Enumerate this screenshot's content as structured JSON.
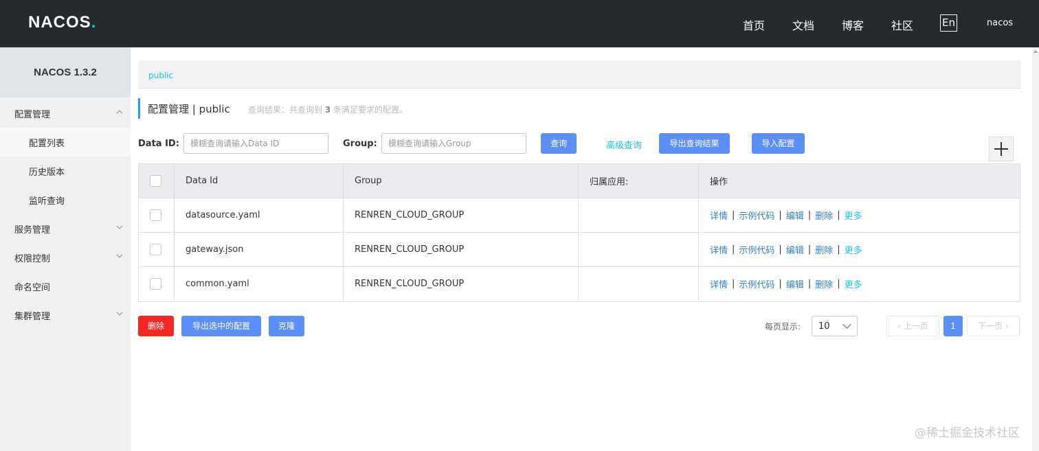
{
  "header": {
    "logo_text": "NACOS.",
    "nav": [
      "首页",
      "文档",
      "博客",
      "社区"
    ],
    "lang": "En",
    "user": "nacos"
  },
  "sidebar": {
    "title": "NACOS 1.3.2",
    "items": [
      {
        "label": "配置管理",
        "type": "group",
        "expanded": true
      },
      {
        "label": "配置列表",
        "type": "sub",
        "active": true
      },
      {
        "label": "历史版本",
        "type": "sub"
      },
      {
        "label": "监听查询",
        "type": "sub"
      },
      {
        "label": "服务管理",
        "type": "group",
        "expanded": false
      },
      {
        "label": "权限控制",
        "type": "group",
        "expanded": false
      },
      {
        "label": "命名空间",
        "type": "item"
      },
      {
        "label": "集群管理",
        "type": "group",
        "expanded": false
      }
    ]
  },
  "breadcrumb": "public",
  "page": {
    "title": "配置管理 | public",
    "result_prefix": "查询结果：共查询到",
    "result_count": "3",
    "result_suffix": "条满足要求的配置。"
  },
  "search": {
    "dataid_label": "Data ID:",
    "dataid_placeholder": "模糊查询请输入Data ID",
    "group_label": "Group:",
    "group_placeholder": "模糊查询请输入Group",
    "query_btn": "查询",
    "advanced_link": "高级查询",
    "export_btn": "导出查询结果",
    "import_btn": "导入配置"
  },
  "table": {
    "columns": [
      "Data Id",
      "Group",
      "归属应用:",
      "操作"
    ],
    "rows": [
      {
        "data_id": "datasource.yaml",
        "group": "RENREN_CLOUD_GROUP",
        "app": ""
      },
      {
        "data_id": "gateway.json",
        "group": "RENREN_CLOUD_GROUP",
        "app": ""
      },
      {
        "data_id": "common.yaml",
        "group": "RENREN_CLOUD_GROUP",
        "app": ""
      }
    ],
    "ops": {
      "detail": "详情",
      "sample": "示例代码",
      "edit": "编辑",
      "delete": "删除",
      "more": "更多"
    }
  },
  "footer": {
    "delete_btn": "删除",
    "export_selected_btn": "导出选中的配置",
    "clone_btn": "克隆",
    "page_size_label": "每页显示:",
    "page_size": "10",
    "prev": "上一页",
    "next": "下一页",
    "current_page": "1"
  },
  "watermark": "@稀土掘金技术社区",
  "colors": {
    "accent": "#5b8ff9",
    "link": "#1ec5d8",
    "danger": "#f52722",
    "header_bg": "#252a2f"
  }
}
